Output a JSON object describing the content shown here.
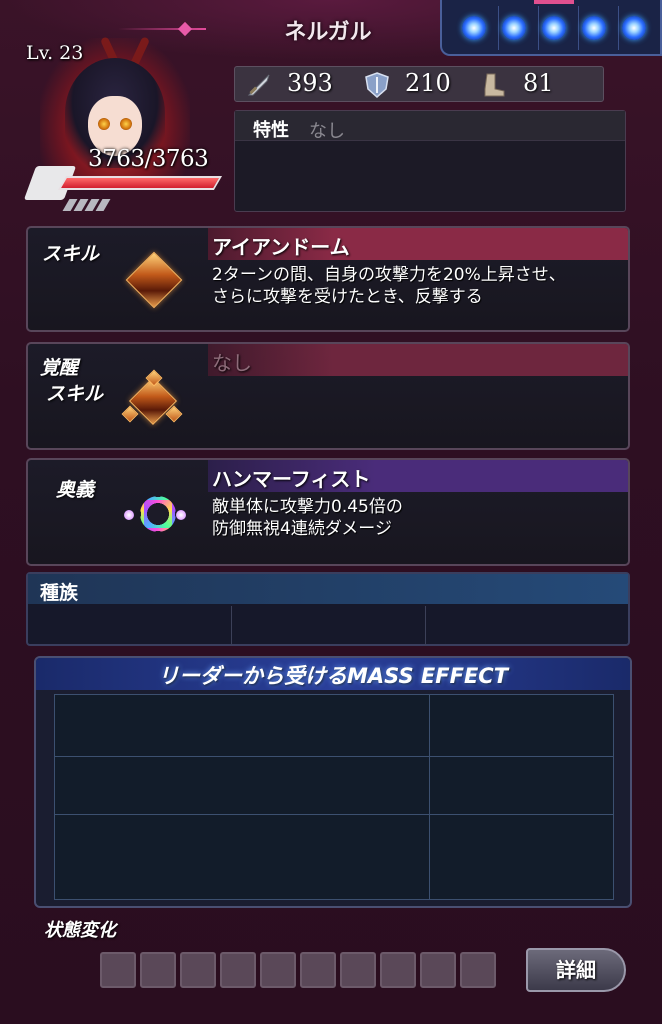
{
  "header": {
    "title": "ネルガル"
  },
  "character": {
    "level": "Lv. 23",
    "hp": "3763/3763",
    "hp_fraction": 1.0
  },
  "stats": {
    "attack": "393",
    "defense": "210",
    "speed": "81"
  },
  "trait": {
    "label": "特性",
    "value": "なし"
  },
  "skill": {
    "label": "スキル",
    "name": "アイアンドーム",
    "description": "2ターンの間、自身の攻撃力を20%上昇させ、\nさらに攻撃を受けたとき、反撃する"
  },
  "awakening": {
    "label_line1": "覚醒",
    "label_line2": "スキル",
    "name": "なし"
  },
  "ougi": {
    "label": "奥義",
    "name": "ハンマーフィスト",
    "description": "敵単体に攻撃力0.45倍の\n防御無視4連続ダメージ"
  },
  "species": {
    "label": "種族"
  },
  "mass_effect": {
    "title": "リーダーから受けるMASS EFFECT"
  },
  "status": {
    "label": "状態変化",
    "detail_button": "詳細"
  },
  "colors": {
    "background": "#2e0f22",
    "skill_head": "#8a2a46",
    "ougi_head": "#4a2c7a",
    "species_head": "#254a78",
    "mass_head": "#2a3f9a"
  },
  "icons": [
    "sword-icon",
    "shield-icon",
    "boot-icon",
    "gem-icon",
    "orb-icon"
  ]
}
